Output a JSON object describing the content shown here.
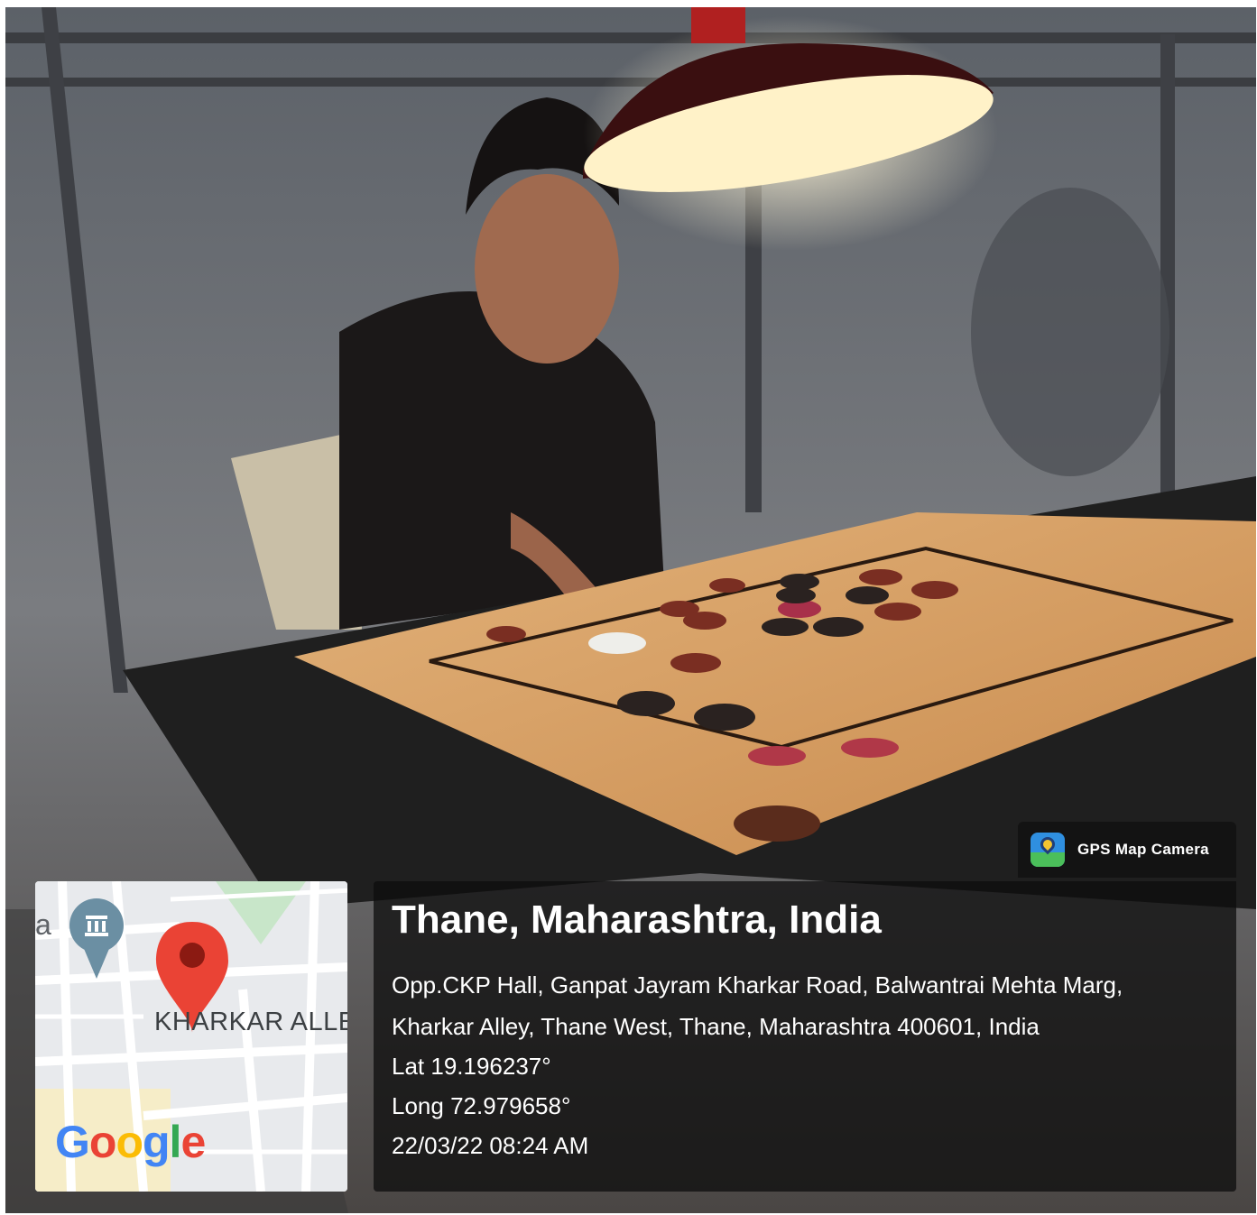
{
  "stamp": {
    "app_name": "GPS Map Camera",
    "app_icon": "gps-map-camera-app-icon",
    "location_title": "Thane, Maharashtra, India",
    "address_line_1": "Opp.CKP Hall, Ganpat Jayram Kharkar Road, Balwantrai Mehta Marg,",
    "address_line_2": "Kharkar Alley, Thane West, Thane, Maharashtra 400601, India",
    "latitude": "Lat 19.196237°",
    "longitude": "Long 72.979658°",
    "datetime": "22/03/22 08:24 AM"
  },
  "map": {
    "street_label": "KHARKAR ALLE",
    "edge_label": "a",
    "logo": [
      "G",
      "o",
      "o",
      "g",
      "l",
      "e"
    ],
    "logo_colors": [
      "#4285F4",
      "#EA4335",
      "#FBBC05",
      "#4285F4",
      "#34A853",
      "#EA4335"
    ],
    "pin_color": "#EA4335",
    "poi_color": "#6b8fa3",
    "park_color": "#c8e6c9"
  },
  "scene": {
    "description_icons": [
      "ceiling-lamp-icon",
      "carrom-board",
      "player"
    ]
  }
}
